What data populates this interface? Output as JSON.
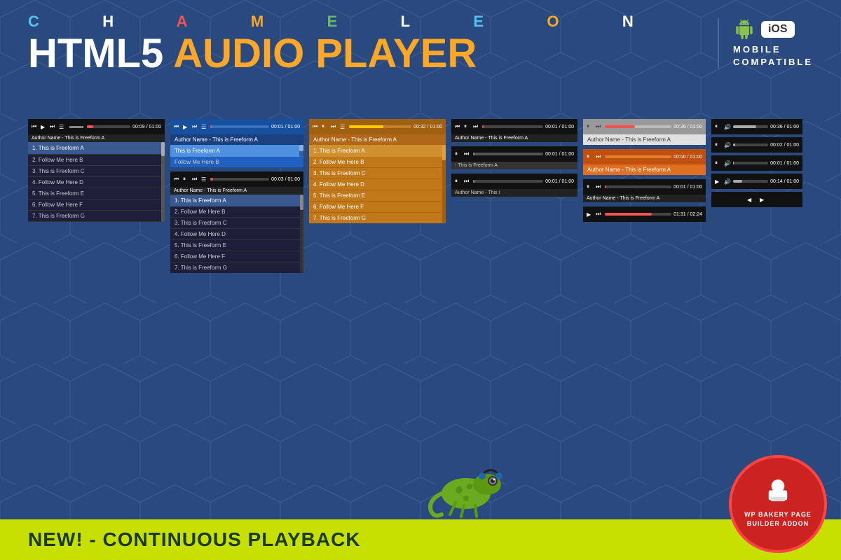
{
  "header": {
    "chameleon_letters": [
      "C",
      "H",
      "A",
      "M",
      "E",
      "L",
      "E",
      "O",
      "N"
    ],
    "title_html5": "HTML5",
    "title_audio": "AUDIO PLAYER",
    "mobile_label1": "MOBILE",
    "mobile_label2": "COMPATIBLE"
  },
  "bottom_bar": {
    "text": "NEW! - CONTINUOUS PLAYBACK"
  },
  "wp_badge": {
    "line1": "WP BAKERY PAGE",
    "line2": "BUILDER ADDON"
  },
  "players": {
    "player1": {
      "time": "00:09 / 01:00",
      "author": "Author Name - This is Freeform A",
      "tracks": [
        "1. This is Freeform A",
        "2. Follow Me Here B",
        "3. This is Freeform C",
        "4. Follow Me Here D",
        "5. This is Freeform E",
        "6. Follow Me Here F",
        "7. This is Freeform G"
      ]
    },
    "player2": {
      "time": "00:01 / 01:00",
      "author": "Author Name - This is Freeform A",
      "active_track": "This is Freeform A",
      "tracks": [
        "Follow Me Here B"
      ]
    },
    "player3": {
      "time": "00:03 / 01:00",
      "author": "Author Name - This is Freeform A",
      "tracks": [
        "1. This is Freeform A",
        "2. Follow Me Here B",
        "3. This is Freeform C",
        "4. Follow Me Here D",
        "5. This is Freeform E",
        "6. Follow Me Here F",
        "7. This is Freeform G"
      ]
    },
    "player4": {
      "time": "00:32 / 01:00",
      "author": "Author Name - This is Freeform A",
      "tracks": [
        "1. This is Freeform A",
        "2. Follow Me Here B",
        "3. This is Freeform C",
        "4. Follow Me Here D",
        "5. This is Freeform E",
        "6. Follow Me Here F",
        "7. This is Freeform G"
      ]
    },
    "player5": {
      "time": "00:01 / 01:00",
      "author": "Author Name - This is Freeform A"
    },
    "player6": {
      "time": "00:01 / 01:00",
      "author": "- This is Freeform A"
    },
    "player7": {
      "time": "00:26 / 01:00",
      "author": "Author Name - This is Freeform A"
    },
    "player8": {
      "time": "00:00 / 01:00",
      "author": "Author Name - This is Freeform A"
    },
    "player9": {
      "time": "00:01 / 01:00",
      "author": "Author Name - This is Freeform A"
    },
    "player10": {
      "time": "01:31 / 02:24"
    },
    "mini1": {
      "time": "00:36 / 01:00"
    },
    "mini2": {
      "time": "00:02 / 01:00"
    },
    "mini3": {
      "time": "00:01 / 01:00"
    },
    "mini4": {
      "time": "00:14 / 01:00"
    },
    "mini5": {
      "time": ""
    }
  }
}
